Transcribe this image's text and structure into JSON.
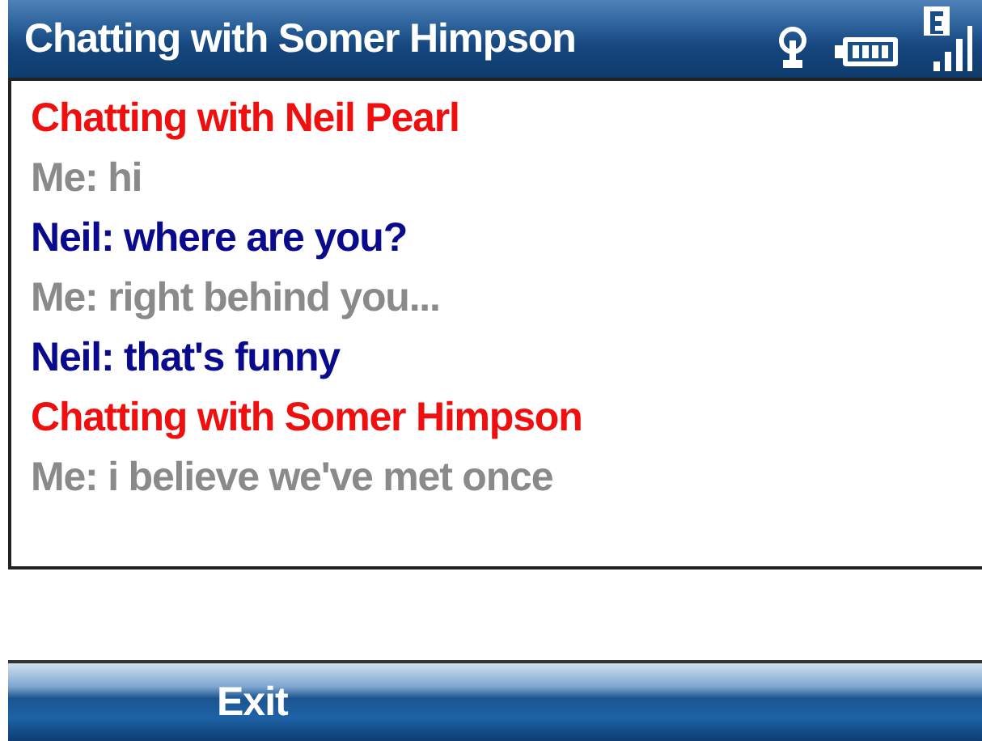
{
  "title_bar": {
    "title": "Chatting with Somer Himpson"
  },
  "messages": [
    {
      "kind": "header",
      "text": "Chatting with Neil Pearl"
    },
    {
      "kind": "me",
      "text": "Me: hi"
    },
    {
      "kind": "them",
      "text": "Neil: where are you?"
    },
    {
      "kind": "me",
      "text": "Me: right behind you..."
    },
    {
      "kind": "them",
      "text": "Neil: that's funny"
    },
    {
      "kind": "header",
      "text": "Chatting with Somer Himpson"
    },
    {
      "kind": "me",
      "text": "Me: i believe we've met once"
    }
  ],
  "soft_keys": {
    "left": "Exit"
  }
}
